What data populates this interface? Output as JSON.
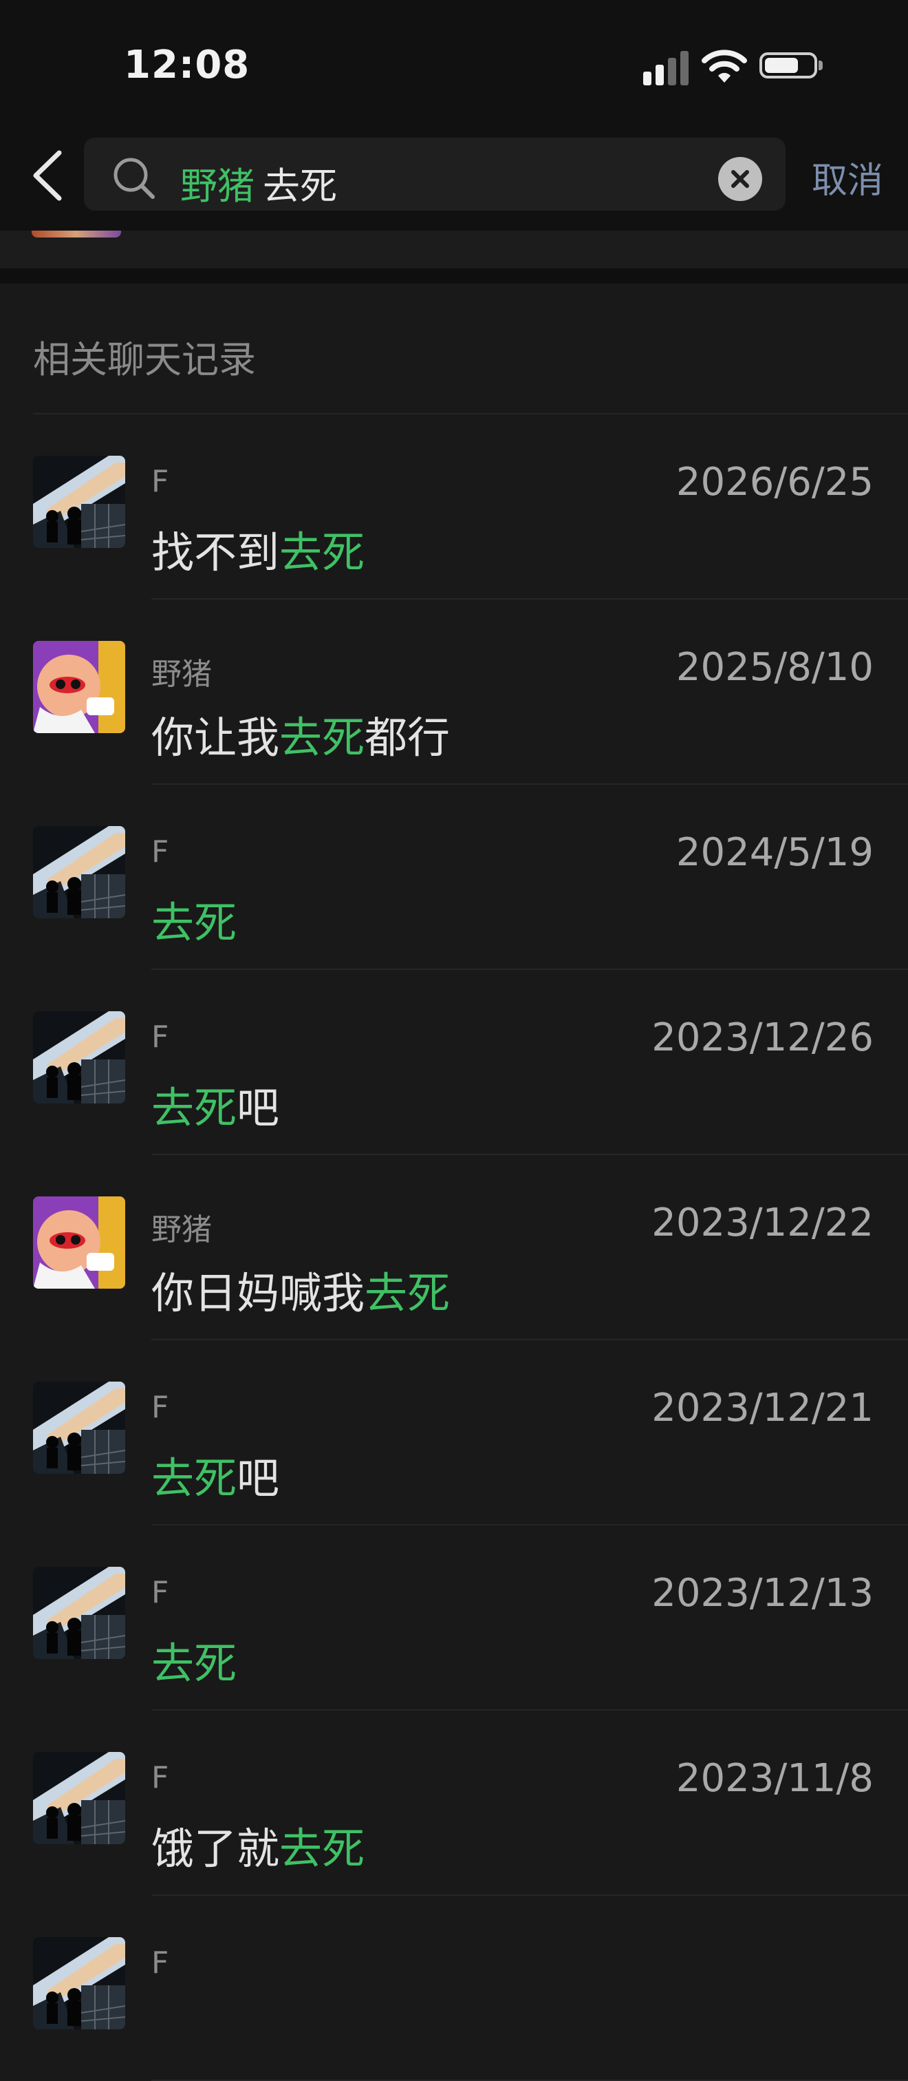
{
  "status_bar": {
    "time": "12:08"
  },
  "search": {
    "query_tag": "野猪",
    "query_text": "去死",
    "cancel_label": "取消"
  },
  "section_title": "相关聊天记录",
  "colors": {
    "highlight": "#3fc165",
    "background": "#191919",
    "cancel": "#7d8fad"
  },
  "results": [
    {
      "sender": "F",
      "date": "2026/6/25",
      "avatar": "photo-f",
      "pre": "找不到",
      "match": "去死",
      "post": ""
    },
    {
      "sender": "野猪",
      "date": "2025/8/10",
      "avatar": "cartoon-yezhu",
      "pre": "你让我",
      "match": "去死",
      "post": "都行"
    },
    {
      "sender": "F",
      "date": "2024/5/19",
      "avatar": "photo-f",
      "pre": "",
      "match": "去死",
      "post": ""
    },
    {
      "sender": "F",
      "date": "2023/12/26",
      "avatar": "photo-f",
      "pre": "",
      "match": "去死",
      "post": "吧"
    },
    {
      "sender": "野猪",
      "date": "2023/12/22",
      "avatar": "cartoon-yezhu",
      "pre": "你日妈喊我",
      "match": "去死",
      "post": ""
    },
    {
      "sender": "F",
      "date": "2023/12/21",
      "avatar": "photo-f",
      "pre": "",
      "match": "去死",
      "post": "吧"
    },
    {
      "sender": "F",
      "date": "2023/12/13",
      "avatar": "photo-f",
      "pre": "",
      "match": "去死",
      "post": ""
    },
    {
      "sender": "F",
      "date": "2023/11/8",
      "avatar": "photo-f",
      "pre": "饿了就",
      "match": "去死",
      "post": ""
    },
    {
      "sender": "F",
      "date": "",
      "avatar": "photo-f",
      "pre": "",
      "match": "",
      "post": ""
    }
  ]
}
